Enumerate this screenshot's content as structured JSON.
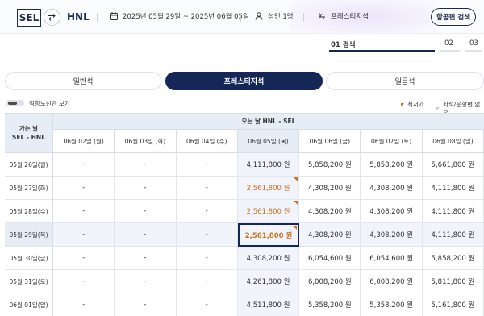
{
  "header": {
    "origin": "SEL",
    "destination": "HNL",
    "dates": "2025년 05월 29일 ~ 2025년 06월 05일",
    "passengers": "성인 1명",
    "cabin": "프레스티지석",
    "search_button": "항공편 검색"
  },
  "steps": [
    {
      "label": "01 검색",
      "active": true
    },
    {
      "label": "02",
      "active": false
    },
    {
      "label": "03",
      "active": false
    }
  ],
  "cabin_tabs": [
    {
      "label": "일반석",
      "active": false
    },
    {
      "label": "프레스티지석",
      "active": true
    },
    {
      "label": "일등석",
      "active": false
    }
  ],
  "filters": {
    "direct_only_label": "직항노선만 보기",
    "legend_lowest": "최저가",
    "legend_selected": "좌석/운항편 없음"
  },
  "table": {
    "corner_line1": "가는 날",
    "corner_line2": "SEL - HNL",
    "return_header": "오는 날 HNL - SEL",
    "columns": [
      "06월 02일 (월)",
      "06월 03일 (화)",
      "06월 04일 (수)",
      "06월 05일 (목)",
      "06월 06일 (금)",
      "06월 07일 (토)",
      "06월 08일 (일)"
    ],
    "rows": [
      {
        "label": "05월 26일(월)",
        "cells": [
          "-",
          "-",
          "-",
          "4,111,800 원",
          "5,858,200 원",
          "5,858,200 원",
          "5,661,800 원"
        ]
      },
      {
        "label": "05월 27일(화)",
        "cells": [
          "-",
          "-",
          "-",
          "2,561,800 원",
          "4,308,200 원",
          "4,308,200 원",
          "4,111,800 원"
        ]
      },
      {
        "label": "05월 28일(수)",
        "cells": [
          "-",
          "-",
          "-",
          "2,561,800 원",
          "4,308,200 원",
          "4,308,200 원",
          "4,111,800 원"
        ]
      },
      {
        "label": "05월 29일(목)",
        "cells": [
          "-",
          "-",
          "-",
          "2,561,800 원",
          "4,308,200 원",
          "4,308,200 원",
          "4,111,800 원"
        ]
      },
      {
        "label": "05월 30일(금)",
        "cells": [
          "-",
          "-",
          "-",
          "4,308,200 원",
          "6,054,600 원",
          "6,054,600 원",
          "5,858,200 원"
        ]
      },
      {
        "label": "05월 31일(토)",
        "cells": [
          "-",
          "-",
          "-",
          "4,261,800 원",
          "6,008,200 원",
          "6,008,200 원",
          "5,811,800 원"
        ]
      },
      {
        "label": "06월 01일(일)",
        "cells": [
          "-",
          "-",
          "-",
          "4,511,800 원",
          "5,358,200 원",
          "5,358,200 원",
          "5,161,800 원"
        ]
      }
    ],
    "highlight_row": 3,
    "highlight_col": 3,
    "lowest_cells": [
      [
        1,
        3
      ],
      [
        2,
        3
      ],
      [
        3,
        3
      ]
    ],
    "selected_cell": [
      3,
      3
    ]
  },
  "colors": {
    "navy": "#152756",
    "lowest": "#c8731f",
    "highlight": "#e6edf7"
  }
}
